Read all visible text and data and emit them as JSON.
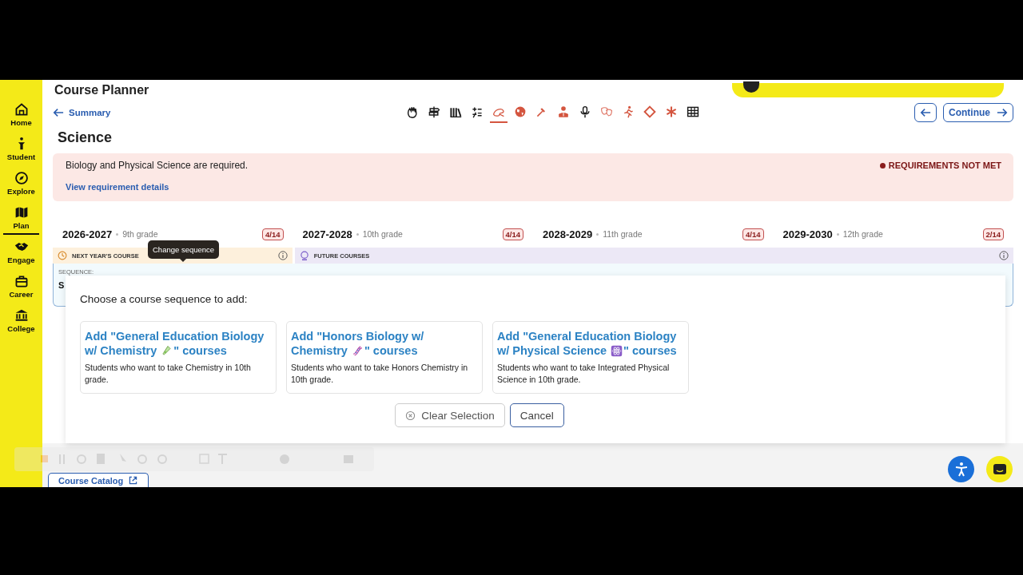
{
  "header": {
    "title": "Course Planner",
    "back_link": "Summary",
    "continue_button": "Continue"
  },
  "sidebar": {
    "items": [
      {
        "label": "Home",
        "selected": false
      },
      {
        "label": "Student",
        "selected": false
      },
      {
        "label": "Explore",
        "selected": false
      },
      {
        "label": "Plan",
        "selected": true
      },
      {
        "label": "Engage",
        "selected": false
      },
      {
        "label": "Career",
        "selected": false
      },
      {
        "label": "College",
        "selected": false
      }
    ]
  },
  "subjects": [
    {
      "color": "#1a1a1a",
      "selected": false
    },
    {
      "color": "#1a1a1a",
      "selected": false
    },
    {
      "color": "#1a1a1a",
      "selected": false
    },
    {
      "color": "#1a1a1a",
      "selected": false
    },
    {
      "color": "#d4553f",
      "selected": true
    },
    {
      "color": "#d4553f",
      "selected": false
    },
    {
      "color": "#d4553f",
      "selected": false
    },
    {
      "color": "#d4553f",
      "selected": false
    },
    {
      "color": "#1a1a1a",
      "selected": false
    },
    {
      "color": "#e07a6a",
      "selected": false
    },
    {
      "color": "#d4553f",
      "selected": false
    },
    {
      "color": "#d4553f",
      "selected": false
    },
    {
      "color": "#d4553f",
      "selected": false
    },
    {
      "color": "#1a1a1a",
      "selected": false
    }
  ],
  "section_title": "Science",
  "requirement": {
    "message": "Biology and Physical Science are required.",
    "link": "View requirement details",
    "status": "REQUIREMENTS NOT MET"
  },
  "years": [
    {
      "year": "2026-2027",
      "grade": "9th grade",
      "count": "4/14"
    },
    {
      "year": "2027-2028",
      "grade": "10th grade",
      "count": "4/14"
    },
    {
      "year": "2028-2029",
      "grade": "11th grade",
      "count": "4/14"
    },
    {
      "year": "2029-2030",
      "grade": "12th grade",
      "count": "2/14"
    }
  ],
  "bands": [
    {
      "kind": "next",
      "label": "NEXT YEAR'S COURSE"
    },
    {
      "kind": "future",
      "label": "FUTURE COURSES"
    }
  ],
  "tooltip": "Change sequence",
  "sequence": {
    "label": "SEQUENCE:",
    "value": "S"
  },
  "popup": {
    "prompt": "Choose a course sequence to add:",
    "options": [
      {
        "kind": "test-tube",
        "title": "Add \"General Education Biology w/ Chemistry",
        "title_end": "\" courses",
        "description": "Students who want to take Chemistry in 10th grade."
      },
      {
        "kind": "dna",
        "title": "Add \"Honors Biology w/ Chemistry",
        "title_end": "\" courses",
        "description": "Students who want to take Honors Chemistry in 10th grade."
      },
      {
        "kind": "atom",
        "title": "Add \"General Education Biology w/ Physical Science",
        "title_end": "\" courses",
        "description": "Students who want to take Integrated Physical Science in 10th grade."
      }
    ],
    "clear_button": "Clear Selection",
    "cancel_button": "Cancel"
  },
  "course_catalog": "Course Catalog"
}
